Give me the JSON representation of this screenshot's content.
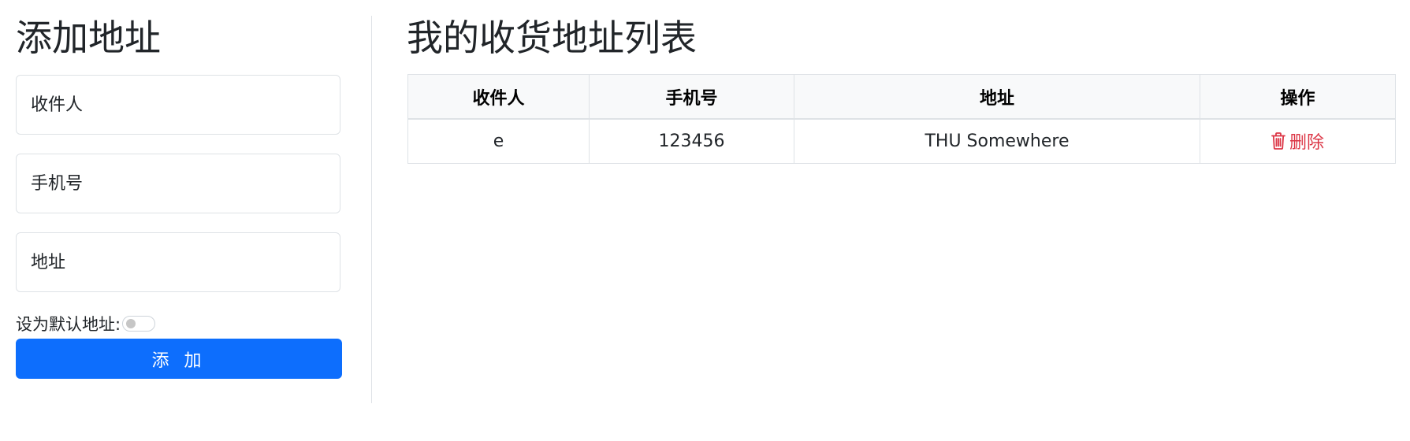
{
  "left": {
    "title": "添加地址",
    "name_placeholder": "收件人",
    "phone_placeholder": "手机号",
    "address_placeholder": "地址",
    "default_label": "设为默认地址:",
    "default_checked": false,
    "add_button_label": "添 加"
  },
  "right": {
    "title": "我的收货地址列表",
    "columns": {
      "name": "收件人",
      "phone": "手机号",
      "address": "地址",
      "action": "操作"
    },
    "rows": [
      {
        "name": "e",
        "phone": "123456",
        "address": "THU Somewhere",
        "action_label": "删除",
        "action_icon": "trash-icon"
      }
    ]
  },
  "colors": {
    "primary": "#0d6efd",
    "danger": "#dc3545",
    "border": "#dee2e6",
    "header_bg": "#f8f9fa"
  }
}
